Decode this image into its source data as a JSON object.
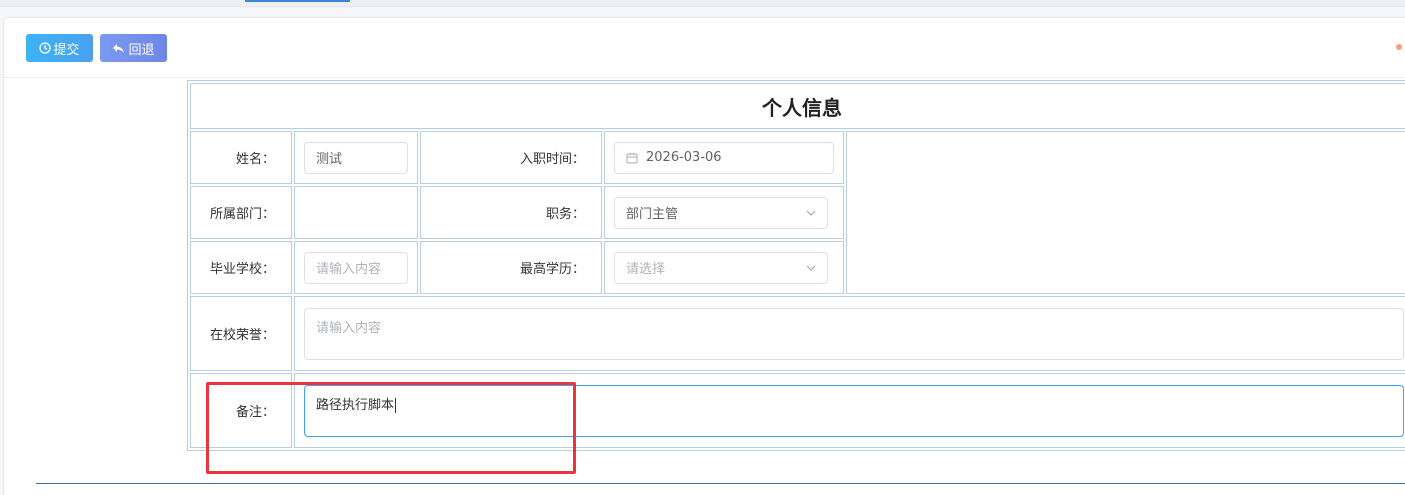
{
  "toolbar": {
    "submit_label": "提交",
    "back_label": "回退"
  },
  "form": {
    "title": "个人信息",
    "name": {
      "label": "姓名：",
      "value": "测试"
    },
    "hire_date": {
      "label": "入职时间：",
      "value": "2026-03-06"
    },
    "department": {
      "label": "所属部门：",
      "value": ""
    },
    "position": {
      "label": "职务：",
      "value": "部门主管"
    },
    "school": {
      "label": "毕业学校：",
      "placeholder": "请输入内容"
    },
    "education": {
      "label": "最高学历：",
      "placeholder": "请选择"
    },
    "honors": {
      "label": "在校荣誉：",
      "placeholder": "请输入内容"
    },
    "remarks": {
      "label": "备注：",
      "value": "路径执行脚本"
    }
  },
  "icons": {
    "submit": "clock-icon",
    "back": "reply-icon",
    "date": "calendar-icon",
    "select": "chevron-down-icon",
    "corner": "share-icon"
  },
  "colors": {
    "submit_button": "#3db4f5",
    "back_button": "#7b9af0",
    "table_border": "#b9cde3",
    "highlight": "#e8353f",
    "focus_border": "#409eff"
  }
}
